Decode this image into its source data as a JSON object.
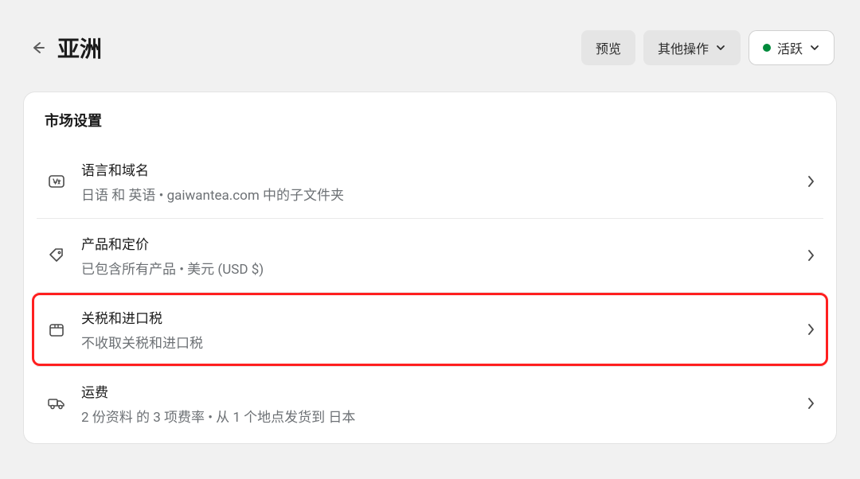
{
  "header": {
    "title": "亚洲",
    "preview_label": "预览",
    "more_actions_label": "其他操作",
    "status_label": "活跃"
  },
  "section_title": "市场设置",
  "items": {
    "langdom": {
      "title": "语言和域名",
      "subtitle": "日语 和 英语 • gaiwantea.com 中的子文件夹"
    },
    "products": {
      "title": "产品和定价",
      "subtitle": "已包含所有产品 • 美元 (USD $)"
    },
    "duties": {
      "title": "关税和进口税",
      "subtitle": "不收取关税和进口税"
    },
    "shipping": {
      "title": "运费",
      "subtitle": "2 份资料 的 3 项费率 • 从 1 个地点发货到 日本"
    }
  }
}
